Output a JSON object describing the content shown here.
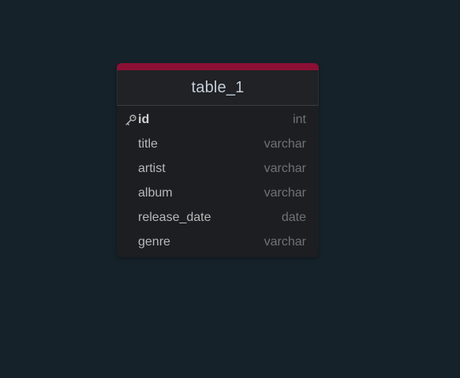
{
  "table": {
    "title": "table_1",
    "accent_color": "#8c1035",
    "columns": [
      {
        "name": "id",
        "type": "int",
        "primary_key": true,
        "icon": "key-icon"
      },
      {
        "name": "title",
        "type": "varchar"
      },
      {
        "name": "artist",
        "type": "varchar"
      },
      {
        "name": "album",
        "type": "varchar"
      },
      {
        "name": "release_date",
        "type": "date"
      },
      {
        "name": "genre",
        "type": "varchar"
      }
    ]
  }
}
